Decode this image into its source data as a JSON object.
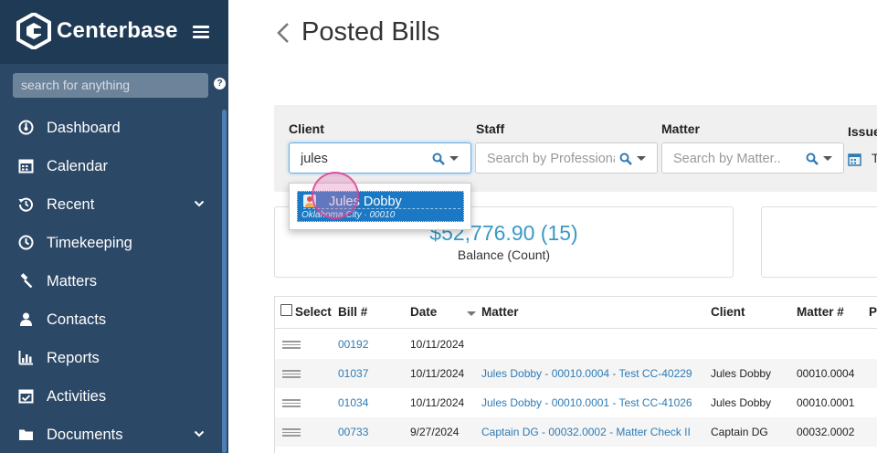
{
  "app": {
    "name": "Centerbase"
  },
  "sidebar": {
    "search_placeholder": "search for anything",
    "help": "?",
    "items": [
      {
        "label": "Dashboard",
        "icon": "dashboard-icon"
      },
      {
        "label": "Calendar",
        "icon": "calendar-icon"
      },
      {
        "label": "Recent",
        "icon": "history-icon",
        "expandable": true
      },
      {
        "label": "Timekeeping",
        "icon": "clock-icon"
      },
      {
        "label": "Matters",
        "icon": "gavel-icon"
      },
      {
        "label": "Contacts",
        "icon": "contacts-icon"
      },
      {
        "label": "Reports",
        "icon": "bar-chart-icon"
      },
      {
        "label": "Activities",
        "icon": "activities-icon"
      },
      {
        "label": "Documents",
        "icon": "folder-icon",
        "expandable": true
      }
    ]
  },
  "page": {
    "title": "Posted Bills"
  },
  "filters": {
    "client": {
      "label": "Client",
      "value": "jules"
    },
    "staff": {
      "label": "Staff",
      "placeholder": "Search by Professiona"
    },
    "matter": {
      "label": "Matter",
      "placeholder": "Search by Matter.."
    },
    "issued": {
      "label": "Issue",
      "value": "T"
    }
  },
  "autocomplete": {
    "name": "Jules Dobby",
    "sub": "Oklahoma City · 00010"
  },
  "summary": {
    "value": "$52,776.90 (15)",
    "label": "Balance (Count)"
  },
  "table": {
    "headers": {
      "select": "Select",
      "bill": "Bill #",
      "date": "Date",
      "matter": "Matter",
      "client": "Client",
      "matter_no": "Matter #",
      "extra": "P"
    },
    "rows": [
      {
        "bill": "00192",
        "date": "10/11/2024",
        "matter": "",
        "client": "",
        "matter_no": ""
      },
      {
        "bill": "01037",
        "date": "10/11/2024",
        "matter": "Jules Dobby - 00010.0004 - Test CC-40229",
        "client": "Jules Dobby",
        "matter_no": "00010.0004"
      },
      {
        "bill": "01034",
        "date": "10/11/2024",
        "matter": "Jules Dobby - 00010.0001 - Test CC-41026",
        "client": "Jules Dobby",
        "matter_no": "00010.0001"
      },
      {
        "bill": "00733",
        "date": "9/27/2024",
        "matter": "Captain DG - 00032.0002 - Matter Check II",
        "client": "Captain DG",
        "matter_no": "00032.0002"
      }
    ]
  },
  "colors": {
    "sidebar": "#2b4866",
    "sidebar_head": "#1f3a55",
    "accent": "#1b78c4",
    "link": "#2e7bb5",
    "summary": "#3a99c7"
  }
}
